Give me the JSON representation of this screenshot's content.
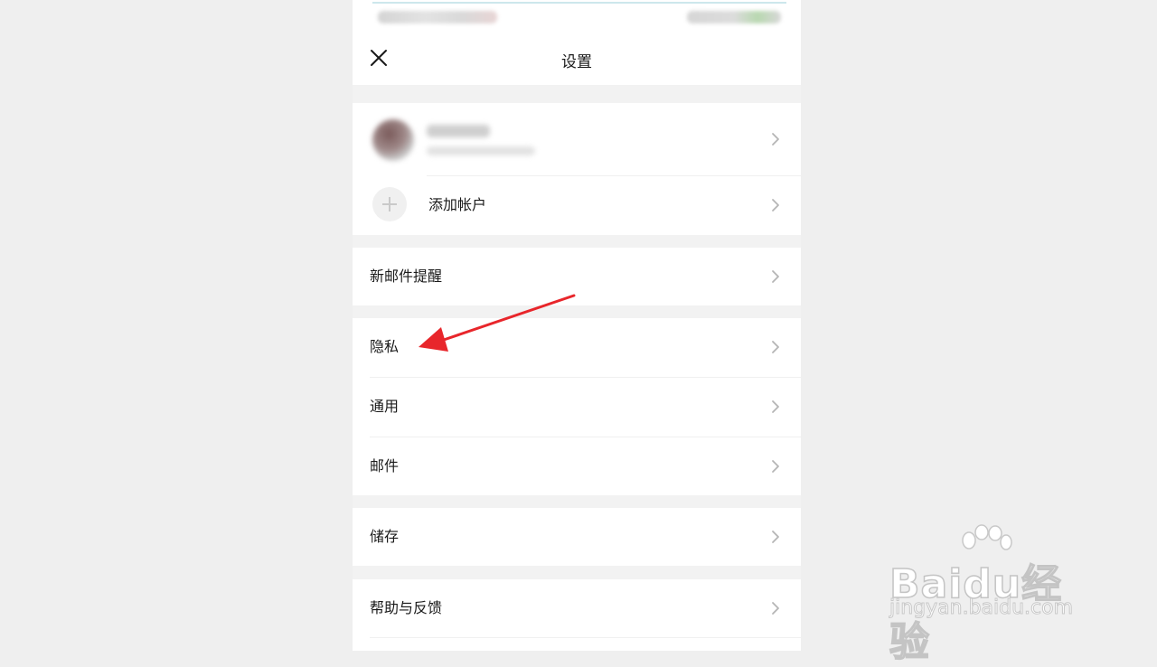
{
  "header": {
    "title": "设置"
  },
  "account": {
    "add_label": "添加帐户"
  },
  "menu": {
    "new_mail_alert": "新邮件提醒",
    "privacy": "隐私",
    "general": "通用",
    "mail": "邮件",
    "storage": "储存",
    "help": "帮助与反馈"
  },
  "watermark": {
    "brand": "Baidu经验",
    "url": "jingyan.baidu.com"
  },
  "colors": {
    "annotation_arrow": "#e8262b",
    "background": "#efefef",
    "card": "#ffffff"
  },
  "icons": {
    "close": "close-icon",
    "chevron": "chevron-right-icon",
    "add": "plus-icon"
  }
}
